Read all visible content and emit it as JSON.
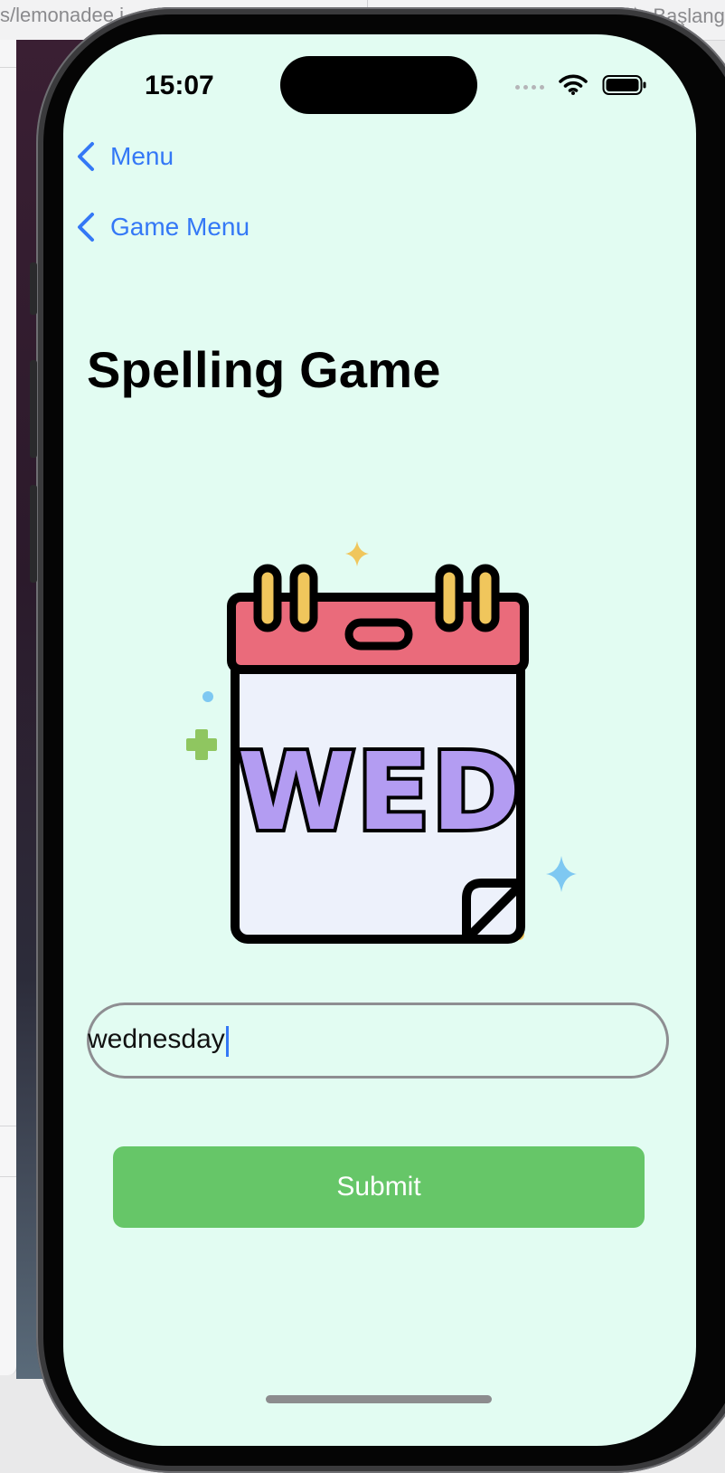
{
  "browser": {
    "url_fragment": "s/lemonadee.i...",
    "bookmark_label": "Başlangı"
  },
  "status_bar": {
    "time": "15:07",
    "icons": [
      "cellular-signal-icon",
      "wifi-icon",
      "battery-icon"
    ]
  },
  "nav": {
    "back_links": [
      {
        "label": "Menu",
        "icon": "chevron-left-icon"
      },
      {
        "label": "Game Menu",
        "icon": "chevron-left-icon"
      }
    ]
  },
  "main": {
    "title": "Spelling Game",
    "illustration": {
      "icon": "calendar-day-icon",
      "text": "WED"
    },
    "answer_field": {
      "value": "wednesday"
    },
    "submit_label": "Submit"
  },
  "colors": {
    "background": "#e2fcf2",
    "link": "#3478f6",
    "submit": "#66c668",
    "calendar_header": "#ea6b7b",
    "calendar_rings": "#f0c65c",
    "calendar_text": "#b39cf2"
  }
}
